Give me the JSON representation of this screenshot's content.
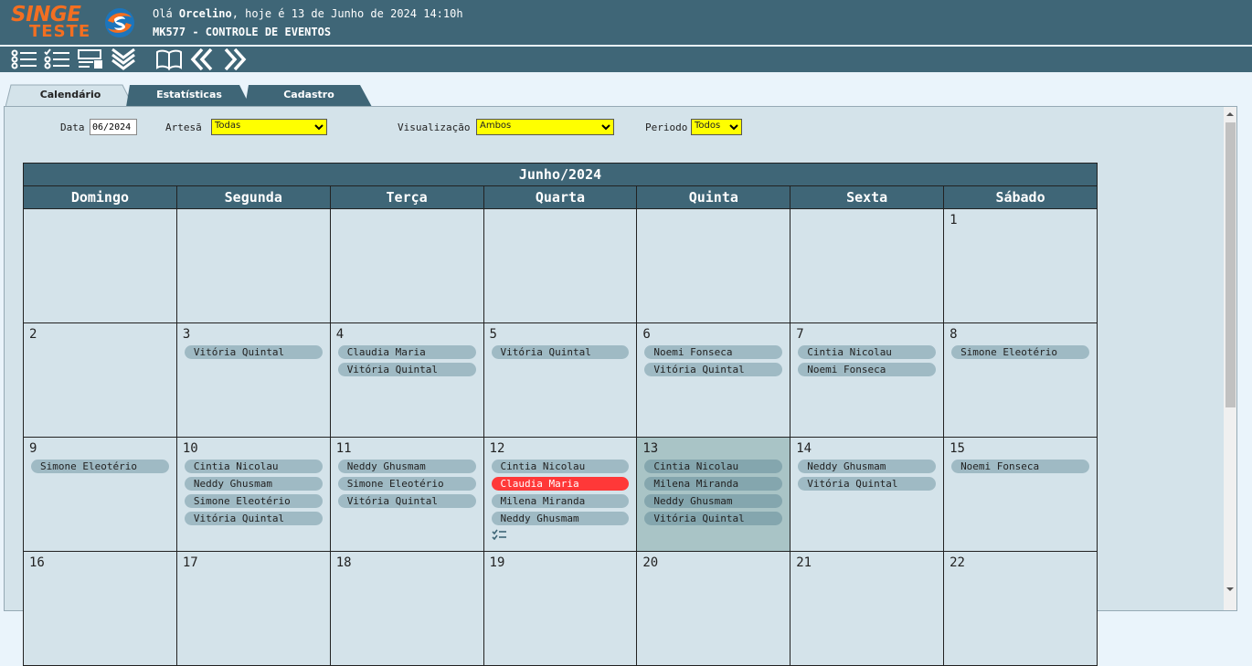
{
  "header": {
    "logo_top": "SINGE",
    "logo_bottom": "TESTE",
    "greeting_prefix": "Olá",
    "user": "Orcelino",
    "greeting_suffix": ", hoje é 13 de Junho de 2024 14:10h",
    "module": "MK577 - CONTROLE DE EVENTOS"
  },
  "colors": {
    "header_bg": "#3f6677",
    "logo_orange": "#f36f21",
    "select_bg": "#ffff00",
    "event_bg": "#9fbac4",
    "event_alert": "#ff3838",
    "today_bg": "#a9c4c6"
  },
  "toolbar": [
    "list-icon",
    "checklist-icon",
    "form-icon",
    "double-chevron-down-icon",
    "book-icon",
    "double-chevron-left-icon",
    "double-chevron-right-icon"
  ],
  "tabs": [
    {
      "label": "Calendário",
      "active": true
    },
    {
      "label": "Estatísticas",
      "active": false
    },
    {
      "label": "Cadastro",
      "active": false
    }
  ],
  "filters": {
    "data_label": "Data",
    "data_value": "06/2024",
    "artesa_label": "Artesã",
    "artesa_value": "Todas",
    "visualizacao_label": "Visualização",
    "visualizacao_value": "Ambos",
    "periodo_label": "Periodo",
    "periodo_value": "Todos"
  },
  "calendar": {
    "month_title": "Junho/2024",
    "weekdays": [
      "Domingo",
      "Segunda",
      "Terça",
      "Quarta",
      "Quinta",
      "Sexta",
      "Sábado"
    ],
    "weeks": [
      [
        {
          "day": "",
          "events": []
        },
        {
          "day": "",
          "events": []
        },
        {
          "day": "",
          "events": []
        },
        {
          "day": "",
          "events": []
        },
        {
          "day": "",
          "events": []
        },
        {
          "day": "",
          "events": []
        },
        {
          "day": "1",
          "events": []
        }
      ],
      [
        {
          "day": "2",
          "events": []
        },
        {
          "day": "3",
          "events": [
            "Vitória Quintal"
          ]
        },
        {
          "day": "4",
          "events": [
            "Claudia Maria",
            "Vitória Quintal"
          ]
        },
        {
          "day": "5",
          "events": [
            "Vitória Quintal"
          ]
        },
        {
          "day": "6",
          "events": [
            "Noemi Fonseca",
            "Vitória Quintal"
          ]
        },
        {
          "day": "7",
          "events": [
            "Cintia Nicolau",
            "Noemi Fonseca"
          ]
        },
        {
          "day": "8",
          "events": [
            "Simone Eleotério"
          ]
        }
      ],
      [
        {
          "day": "9",
          "events": [
            "Simone Eleotério"
          ]
        },
        {
          "day": "10",
          "events": [
            "Cintia Nicolau",
            "Neddy Ghusmam",
            "Simone Eleotério",
            "Vitória Quintal"
          ]
        },
        {
          "day": "11",
          "events": [
            "Neddy Ghusmam",
            "Simone Eleotério",
            "Vitória Quintal"
          ]
        },
        {
          "day": "12",
          "events": [
            "Cintia Nicolau",
            "Claudia Maria",
            "Milena Miranda",
            "Neddy Ghusmam"
          ],
          "alert_index": 1,
          "checklist": true
        },
        {
          "day": "13",
          "events": [
            "Cintia Nicolau",
            "Milena Miranda",
            "Neddy Ghusmam",
            "Vitória Quintal"
          ],
          "today": true
        },
        {
          "day": "14",
          "events": [
            "Neddy Ghusmam",
            "Vitória Quintal"
          ]
        },
        {
          "day": "15",
          "events": [
            "Noemi Fonseca"
          ]
        }
      ],
      [
        {
          "day": "16",
          "events": []
        },
        {
          "day": "17",
          "events": []
        },
        {
          "day": "18",
          "events": []
        },
        {
          "day": "19",
          "events": []
        },
        {
          "day": "20",
          "events": []
        },
        {
          "day": "21",
          "events": []
        },
        {
          "day": "22",
          "events": []
        }
      ]
    ]
  }
}
